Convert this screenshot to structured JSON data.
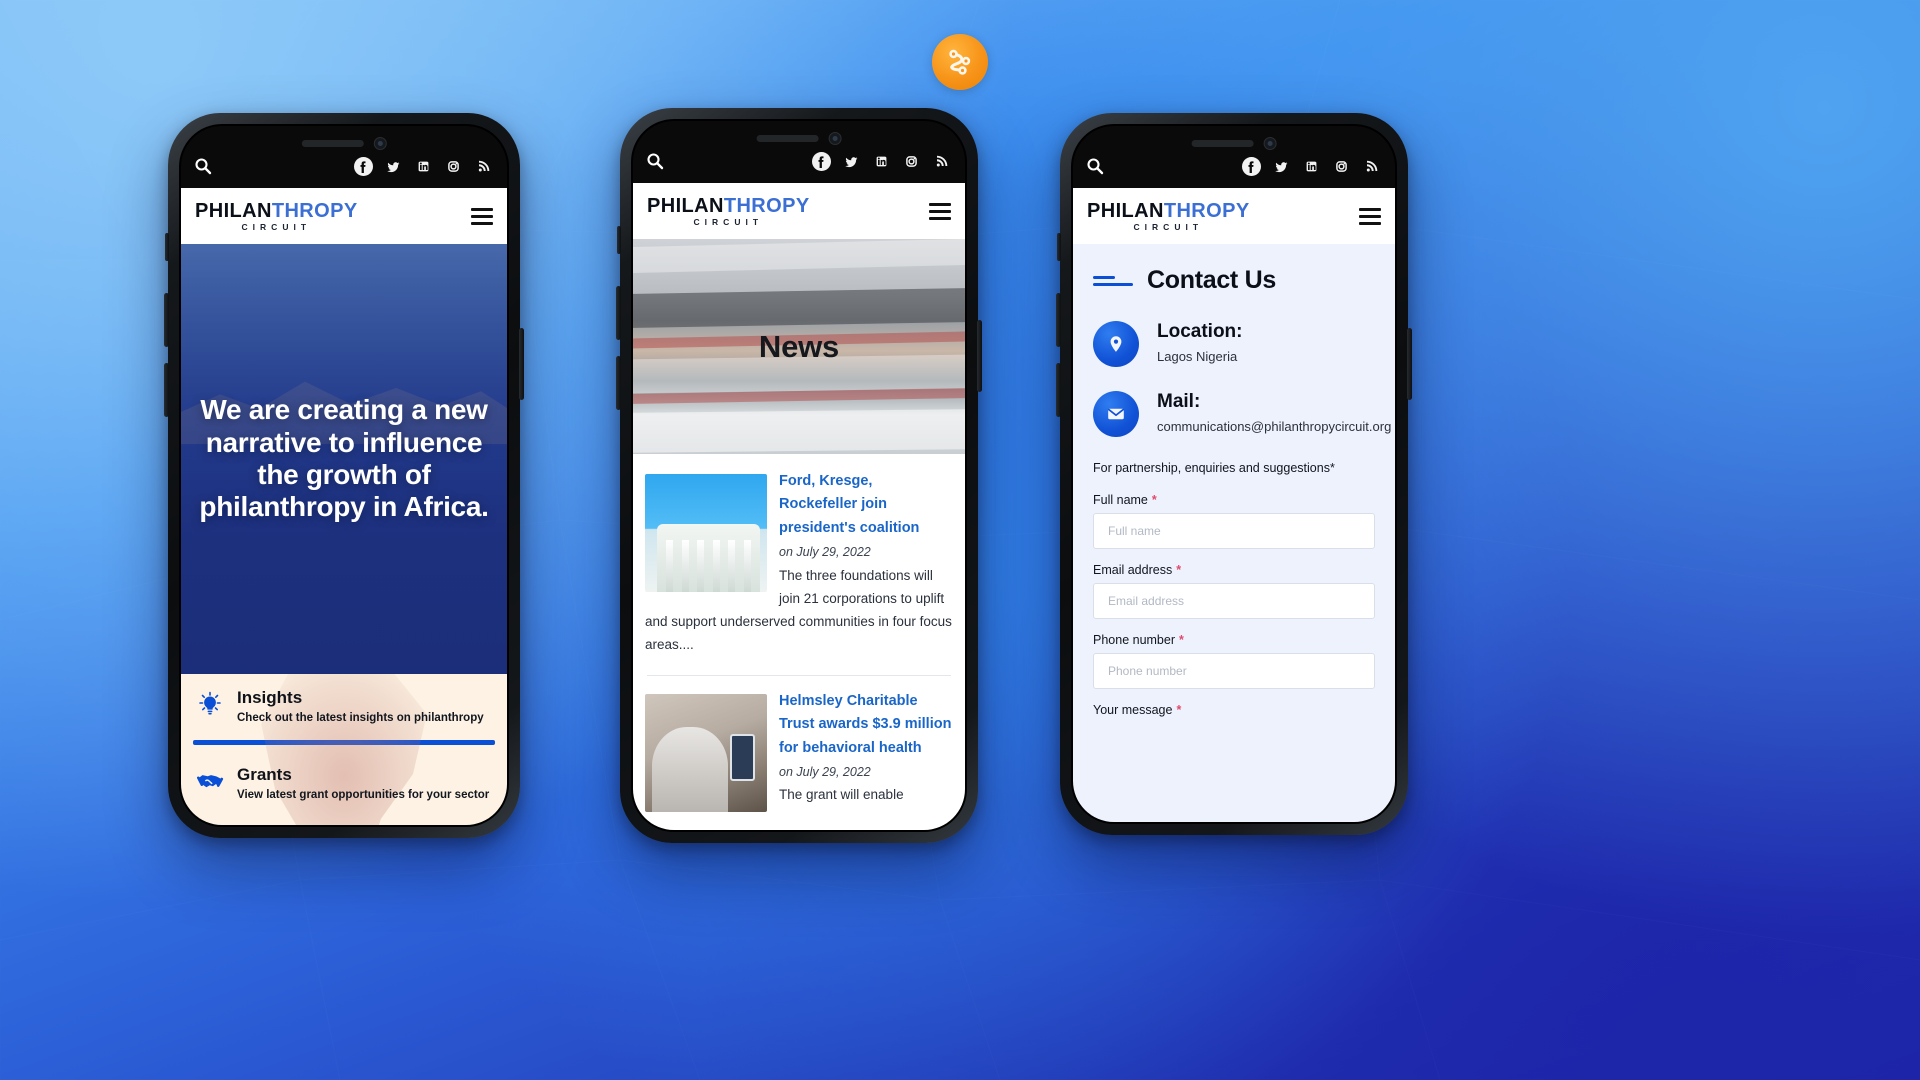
{
  "brand": {
    "logo_icon": "circuit-node-logo-icon",
    "accent_orange": "#f79419",
    "accent_blue": "#0b4fd6",
    "link_blue": "#1a66c8"
  },
  "site_header": {
    "logo_part1": "PHILAN",
    "logo_part2": "THROPY",
    "logo_sub": "CIRCUIT",
    "menu_icon": "hamburger-menu-icon"
  },
  "status_bar": {
    "search_icon": "search-icon",
    "socials": [
      {
        "name": "facebook-icon",
        "glyph": "f"
      },
      {
        "name": "twitter-icon",
        "glyph": "t"
      },
      {
        "name": "linkedin-icon",
        "glyph": "in"
      },
      {
        "name": "instagram-icon",
        "glyph": "ig"
      },
      {
        "name": "rss-icon",
        "glyph": "rss"
      }
    ]
  },
  "phone1": {
    "hero_headline": "We are creating a new narrative to influence the growth of philanthropy in Africa.",
    "cards": [
      {
        "icon": "lightbulb-icon",
        "title": "Insights",
        "description": "Check out the latest insights on philanthropy"
      },
      {
        "icon": "handshake-icon",
        "title": "Grants",
        "description": "View latest grant opportunities for your sector"
      }
    ]
  },
  "phone2": {
    "page_title": "News",
    "articles": [
      {
        "thumb": "white-house-photo",
        "title": "Ford, Kresge, Rockefeller join president's coalition",
        "date": "on July 29, 2022",
        "excerpt": "The three foundations will join 21 corporations to uplift and support underserved communities in four focus areas...."
      },
      {
        "thumb": "telehealth-photo",
        "title": "Helmsley Charitable Trust awards $3.9 million for behavioral health",
        "date": "on July 29, 2022",
        "excerpt": "The grant will enable"
      }
    ]
  },
  "phone3": {
    "section_title": "Contact Us",
    "info": [
      {
        "icon": "location-pin-icon",
        "label": "Location:",
        "value": "Lagos Nigeria"
      },
      {
        "icon": "mail-envelope-icon",
        "label": "Mail:",
        "value": "communications@philanthropycircuit.org"
      }
    ],
    "form": {
      "lead": "For partnership, enquiries and suggestions*",
      "required_mark": "*",
      "fields": [
        {
          "label": "Full name",
          "placeholder": "Full name",
          "value": ""
        },
        {
          "label": "Email address",
          "placeholder": "Email address",
          "value": ""
        },
        {
          "label": "Phone number",
          "placeholder": "Phone number",
          "value": ""
        },
        {
          "label": "Your message",
          "placeholder": "Your message",
          "value": ""
        }
      ]
    }
  }
}
